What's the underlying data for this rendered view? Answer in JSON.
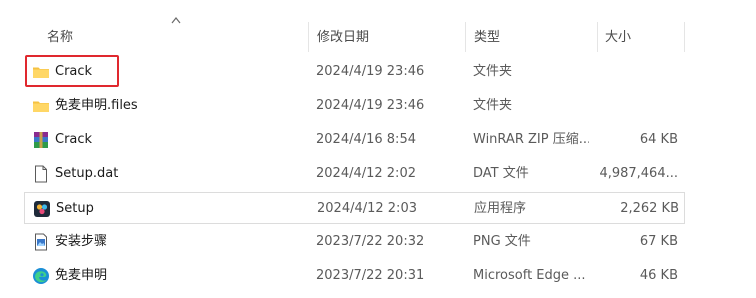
{
  "columns": {
    "name": "名称",
    "modified": "修改日期",
    "type": "类型",
    "size": "大小"
  },
  "files": [
    {
      "icon": "folder-icon",
      "name": "Crack",
      "modified": "2024/4/19 23:46",
      "type": "文件夹",
      "size": ""
    },
    {
      "icon": "folder-icon",
      "name": "免麦申明.files",
      "modified": "2024/4/19 23:46",
      "type": "文件夹",
      "size": ""
    },
    {
      "icon": "winrar-archive-icon",
      "name": "Crack",
      "modified": "2024/4/16 8:54",
      "type": "WinRAR ZIP 压缩...",
      "size": "64 KB"
    },
    {
      "icon": "document-icon",
      "name": "Setup.dat",
      "modified": "2024/4/12 2:02",
      "type": "DAT 文件",
      "size": "4,987,464..."
    },
    {
      "icon": "setup-app-icon",
      "name": "Setup",
      "modified": "2024/4/12 2:03",
      "type": "应用程序",
      "size": "2,262 KB"
    },
    {
      "icon": "png-image-icon",
      "name": "安装步骤",
      "modified": "2023/7/22 20:32",
      "type": "PNG 文件",
      "size": "67 KB"
    },
    {
      "icon": "edge-html-icon",
      "name": "免麦申明",
      "modified": "2023/7/22 20:31",
      "type": "Microsoft Edge ...",
      "size": "46 KB"
    }
  ],
  "colors": {
    "highlight_border": "#e0282e",
    "folder": "#f5c242",
    "selected_border": "#dcdcdc"
  }
}
